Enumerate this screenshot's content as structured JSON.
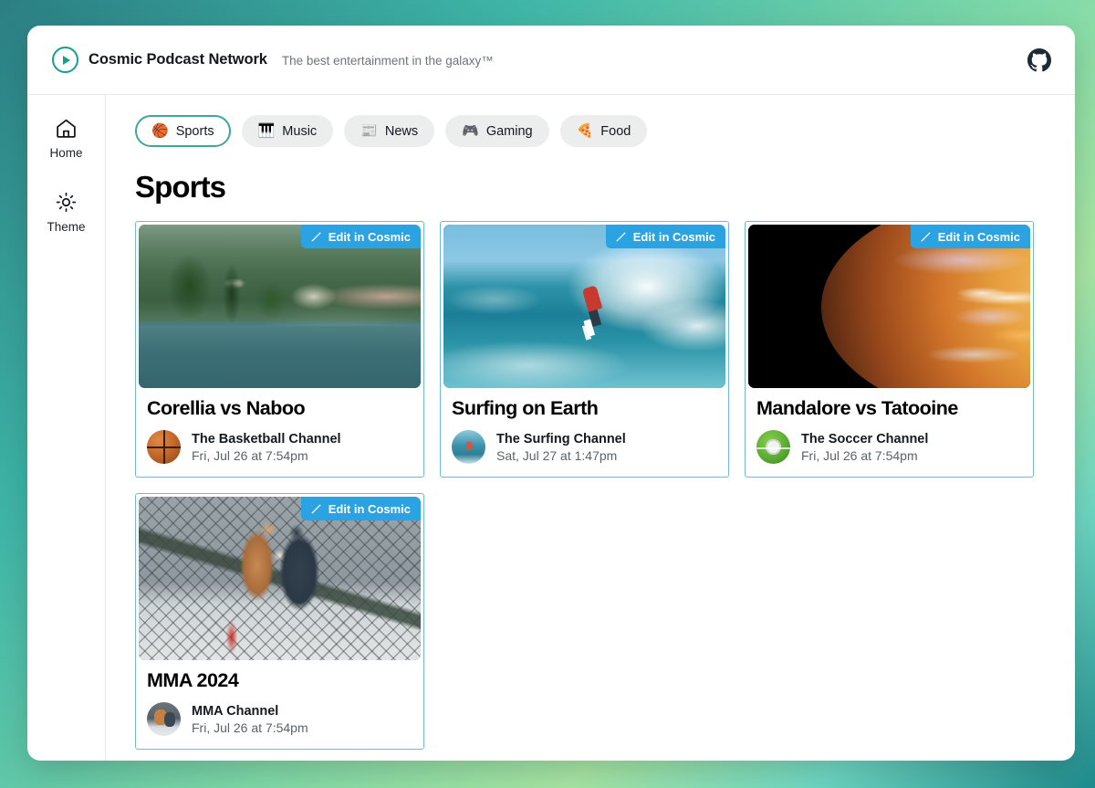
{
  "header": {
    "brand_name": "Cosmic Podcast Network",
    "tagline": "The best entertainment in the galaxy™",
    "logo_icon": "play-circle-icon",
    "github_icon": "github-icon",
    "accent_color": "#16a085"
  },
  "sidebar": {
    "items": [
      {
        "label": "Home",
        "icon": "home-icon"
      },
      {
        "label": "Theme",
        "icon": "sun-icon"
      }
    ]
  },
  "tabs": [
    {
      "label": "Sports",
      "emoji": "🏀",
      "active": true
    },
    {
      "label": "Music",
      "emoji": "🎹",
      "active": false
    },
    {
      "label": "News",
      "emoji": "📰",
      "active": false
    },
    {
      "label": "Gaming",
      "emoji": "🎮",
      "active": false
    },
    {
      "label": "Food",
      "emoji": "🍕",
      "active": false
    }
  ],
  "main": {
    "page_title": "Sports",
    "edit_badge_label": "Edit in Cosmic",
    "edit_badge_icon": "pencil-icon",
    "edit_badge_color": "#2ba2e2",
    "card_border_color": "#6fb9e0"
  },
  "cards": [
    {
      "title": "Corellia vs Naboo",
      "channel": "The Basketball Channel",
      "airtime": "Fri, Jul 26 at 7:54pm",
      "thumbnail": "lakeside-villa-photo",
      "avatar": "basketball-avatar"
    },
    {
      "title": "Surfing on Earth",
      "channel": "The Surfing Channel",
      "airtime": "Sat, Jul 27 at 1:47pm",
      "thumbnail": "surfer-wave-photo",
      "avatar": "surfing-avatar"
    },
    {
      "title": "Mandalore vs Tatooine",
      "channel": "The Soccer Channel",
      "airtime": "Fri, Jul 26 at 7:54pm",
      "thumbnail": "planet-swirl-photo",
      "avatar": "soccer-avatar"
    },
    {
      "title": "MMA 2024",
      "channel": "MMA Channel",
      "airtime": "Fri, Jul 26 at 7:54pm",
      "thumbnail": "mma-fighters-photo",
      "avatar": "mma-avatar"
    }
  ]
}
